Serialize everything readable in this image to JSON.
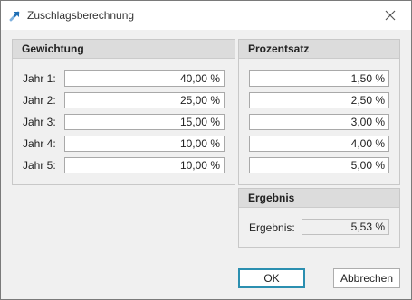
{
  "window": {
    "title": "Zuschlagsberechnung",
    "icon": "arrow-up-right-icon",
    "close_icon": "close-icon"
  },
  "gewichtung": {
    "header": "Gewichtung",
    "rows": [
      {
        "label": "Jahr 1:",
        "value": "40,00 %"
      },
      {
        "label": "Jahr 2:",
        "value": "25,00 %"
      },
      {
        "label": "Jahr 3:",
        "value": "15,00 %"
      },
      {
        "label": "Jahr 4:",
        "value": "10,00 %"
      },
      {
        "label": "Jahr 5:",
        "value": "10,00 %"
      }
    ]
  },
  "prozentsatz": {
    "header": "Prozentsatz",
    "values": [
      "1,50 %",
      "2,50 %",
      "3,00 %",
      "4,00 %",
      "5,00 %"
    ]
  },
  "ergebnis": {
    "header": "Ergebnis",
    "label": "Ergebnis:",
    "value": "5,53 %"
  },
  "buttons": {
    "ok": "OK",
    "cancel": "Abbrechen"
  },
  "colors": {
    "accent": "#2b8fb0",
    "header_bg": "#dcdcdc",
    "window_bg": "#f0f0f0"
  }
}
